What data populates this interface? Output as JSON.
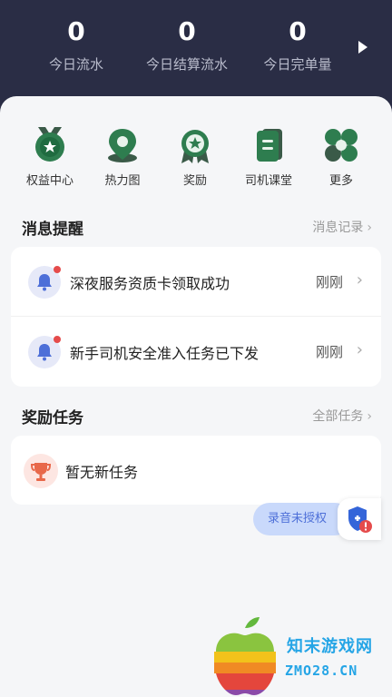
{
  "stats": [
    {
      "value": "0",
      "label": "今日流水"
    },
    {
      "value": "0",
      "label": "今日结算流水"
    },
    {
      "value": "0",
      "label": "今日完单量"
    }
  ],
  "quick_actions": [
    {
      "label": "权益中心",
      "icon": "medal-star-icon"
    },
    {
      "label": "热力图",
      "icon": "map-pin-icon"
    },
    {
      "label": "奖励",
      "icon": "award-star-icon"
    },
    {
      "label": "司机课堂",
      "icon": "book-icon"
    },
    {
      "label": "更多",
      "icon": "more-grid-icon"
    }
  ],
  "messages": {
    "title": "消息提醒",
    "link": "消息记录",
    "items": [
      {
        "text": "深夜服务资质卡领取成功",
        "time": "刚刚"
      },
      {
        "text": "新手司机安全准入任务已下发",
        "time": "刚刚"
      }
    ]
  },
  "tasks": {
    "title": "奖励任务",
    "link": "全部任务",
    "empty_text": "暂无新任务"
  },
  "recording": {
    "label": "录音未授权"
  },
  "watermark": {
    "name": "知末游戏网",
    "url": "ZMO28.CN"
  },
  "colors": {
    "header_bg": "#2a2d45",
    "icon_green": "#2e7d4f",
    "accent_blue": "#4d6fd8",
    "alert_red": "#e54b4b"
  }
}
